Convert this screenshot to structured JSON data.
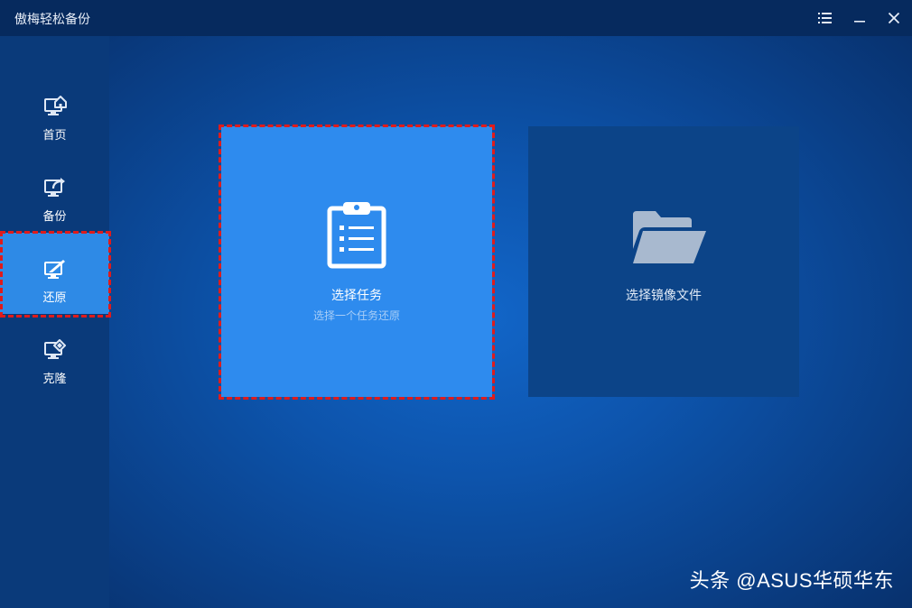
{
  "app": {
    "title": "傲梅轻松备份"
  },
  "window_controls": {
    "menu_icon": "list-icon",
    "minimize_icon": "minimize-icon",
    "close_icon": "close-icon"
  },
  "sidebar": {
    "items": [
      {
        "label": "首页",
        "icon": "monitor-home-icon"
      },
      {
        "label": "备份",
        "icon": "monitor-backup-icon"
      },
      {
        "label": "还原",
        "icon": "monitor-restore-icon",
        "active": true
      },
      {
        "label": "克隆",
        "icon": "monitor-clone-icon"
      }
    ]
  },
  "main": {
    "cards": [
      {
        "title": "选择任务",
        "subtitle": "选择一个任务还原",
        "icon": "clipboard-list-icon",
        "selected": true
      },
      {
        "title": "选择镜像文件",
        "icon": "folder-open-icon"
      }
    ]
  },
  "watermark": "头条 @ASUS华硕华东",
  "colors": {
    "accent": "#2e8bee",
    "highlight_border": "#e01b1b",
    "sidebar_bg": "#0a3a7a",
    "titlebar_bg": "#062a5e"
  }
}
